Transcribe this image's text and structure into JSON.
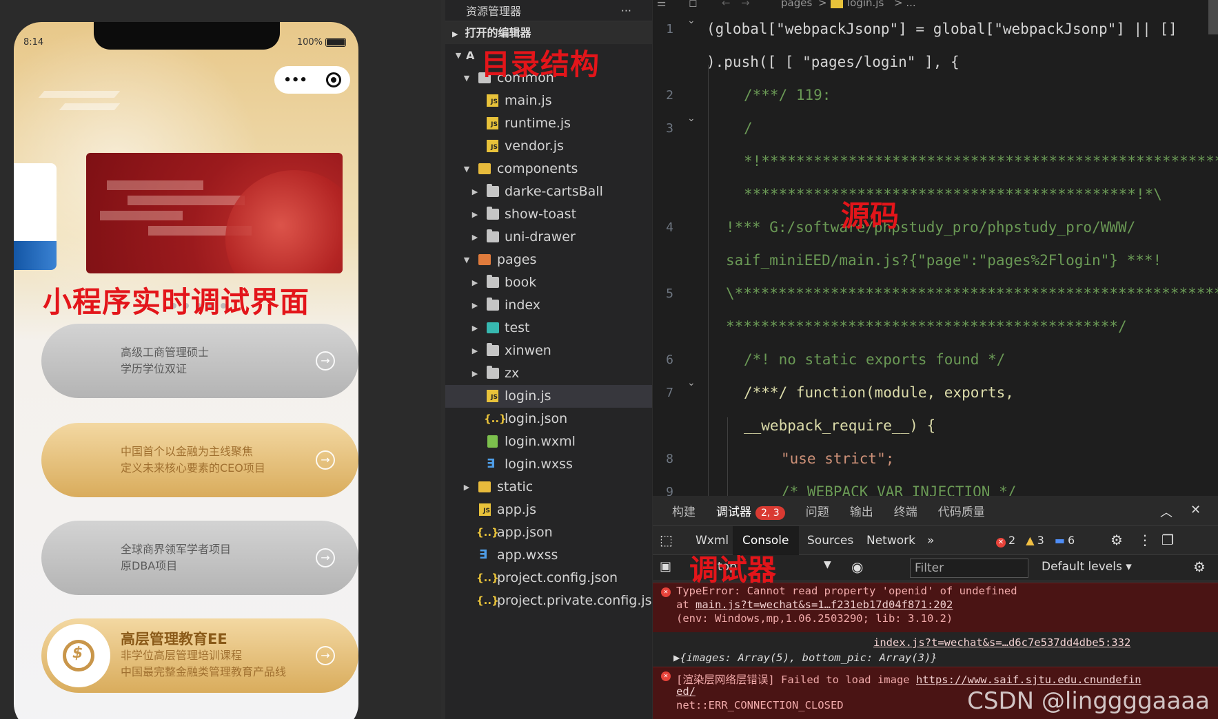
{
  "phone": {
    "time": "8:14",
    "battery": "100%",
    "overlay_label": "小程序实时调试界面",
    "cards": [
      {
        "line1": "高级工商管理硕士",
        "line2": "学历学位双证"
      },
      {
        "line1": "中国首个以金融为主线聚焦",
        "line2": "定义未来核心要素的CEO项目"
      },
      {
        "line1": "全球商界领军学者项目",
        "line2": "原DBA项目"
      },
      {
        "title": "高层管理教育EE",
        "line1": "非学位高层管理培训课程",
        "line2": "中国最完整金融类管理教育产品线"
      }
    ]
  },
  "explorer": {
    "title": "资源管理器",
    "more": "···",
    "open_editors": "打开的编辑器",
    "root_label": "A",
    "overlay_label": "目录结构",
    "items": [
      {
        "label": "common"
      },
      {
        "label": "main.js"
      },
      {
        "label": "runtime.js"
      },
      {
        "label": "vendor.js"
      },
      {
        "label": "components"
      },
      {
        "label": "darke-cartsBall"
      },
      {
        "label": "show-toast"
      },
      {
        "label": "uni-drawer"
      },
      {
        "label": "pages"
      },
      {
        "label": "book"
      },
      {
        "label": "index"
      },
      {
        "label": "test"
      },
      {
        "label": "xinwen"
      },
      {
        "label": "zx"
      },
      {
        "label": "login.js"
      },
      {
        "label": "login.json"
      },
      {
        "label": "login.wxml"
      },
      {
        "label": "login.wxss"
      },
      {
        "label": "static"
      },
      {
        "label": "app.js"
      },
      {
        "label": "app.json"
      },
      {
        "label": "app.wxss"
      },
      {
        "label": "project.config.json"
      },
      {
        "label": "project.private.config.js..."
      }
    ]
  },
  "editor": {
    "breadcrumb": [
      "pages",
      ">",
      "login.js",
      "> ..."
    ],
    "overlay_label": "源码",
    "line_numbers": [
      "1",
      "2",
      "3",
      "4",
      "5",
      "6",
      "7",
      "8",
      "9"
    ],
    "code": {
      "l1a": "(global[\"webpackJsonp\"] = global[\"webpackJsonp\"] || []",
      "l1b": ").push([ [ \"pages/login\" ], {",
      "l2": "/***/ 119:",
      "l3a": "/",
      "l3b": "*!*********************************************************",
      "l3c": "*********************************************!*\\",
      "l4a": "!*** G:/software/phpstudy_pro/phpstudy_pro/WWW/",
      "l4b": "saif_miniEED/main.js?{\"page\":\"pages%2Flogin\"} ***!",
      "l5a": "\\*********************************************************",
      "l5b": "*********************************************/",
      "l6": "/*! no static exports found */",
      "l7a": "/***/ function(module, exports,",
      "l7b": "__webpack_require__) {",
      "l8": "\"use strict\";",
      "l9": "/* WEBPACK VAR INJECTION */"
    }
  },
  "debugger": {
    "tabs": [
      "构建",
      "调试器",
      "问题",
      "输出",
      "终端",
      "代码质量"
    ],
    "badge": "2, 3",
    "overlay_label": "调试器",
    "tool_tabs": [
      "Wxml",
      "Console",
      "Sources",
      "Network",
      "»"
    ],
    "counts": {
      "errors": "2",
      "warnings": "3",
      "info": "6"
    },
    "context": "top",
    "filter_placeholder": "Filter",
    "levels": "Default levels ▾",
    "messages": {
      "m1_l1": "TypeError: Cannot read property 'openid' of undefined",
      "m1_l2_prefix": "    at ",
      "m1_l2_link": "main.js?t=wechat&s=1…f231eb17d04f871:202",
      "m1_l3": "(env: Windows,mp,1.06.2503290; lib: 3.10.2)",
      "m2_link": "index.js?t=wechat&s=…d6c7e537dd4dbe5:332",
      "m2_obj": "▶{images: Array(5), bottom_pic: Array(3)}",
      "m3_l1_prefix": "[渲染层网络层错误] Failed to load image ",
      "m3_l1_link": "https://www.saif.sjtu.edu.cnundefin",
      "m3_l2": "ed/",
      "m3_l3": "net::ERR_CONNECTION_CLOSED"
    }
  },
  "watermark": "CSDN @linggggaaaa"
}
